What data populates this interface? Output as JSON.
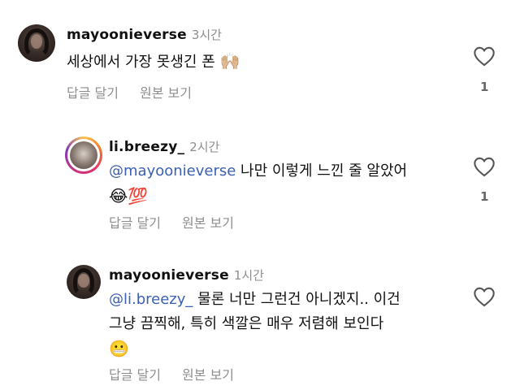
{
  "comments": [
    {
      "username": "mayoonieverse",
      "time": "3시간",
      "text": "세상에서 가장 못생긴 폰",
      "emoji": "🙌🏼",
      "reply_label": "답글 달기",
      "original_label": "원본 보기",
      "like_count": "1"
    },
    {
      "username": "li.breezy_",
      "time": "2시간",
      "mention": "@mayoonieverse",
      "text": " 나만 이렇게 느낀 줄 알았어",
      "emoji": "😂💯",
      "reply_label": "답글 달기",
      "original_label": "원본 보기",
      "like_count": "1"
    },
    {
      "username": "mayoonieverse",
      "time": "1시간",
      "mention": "@li.breezy_",
      "text_line1": " 물론 너만 그런건 아니겠지.. 이건",
      "text_line2": "그냥 끔찍해, 특히 색깔은 매우 저렴해 보인다",
      "emoji": "😬",
      "reply_label": "답글 달기",
      "original_label": "원본 보기"
    }
  ]
}
